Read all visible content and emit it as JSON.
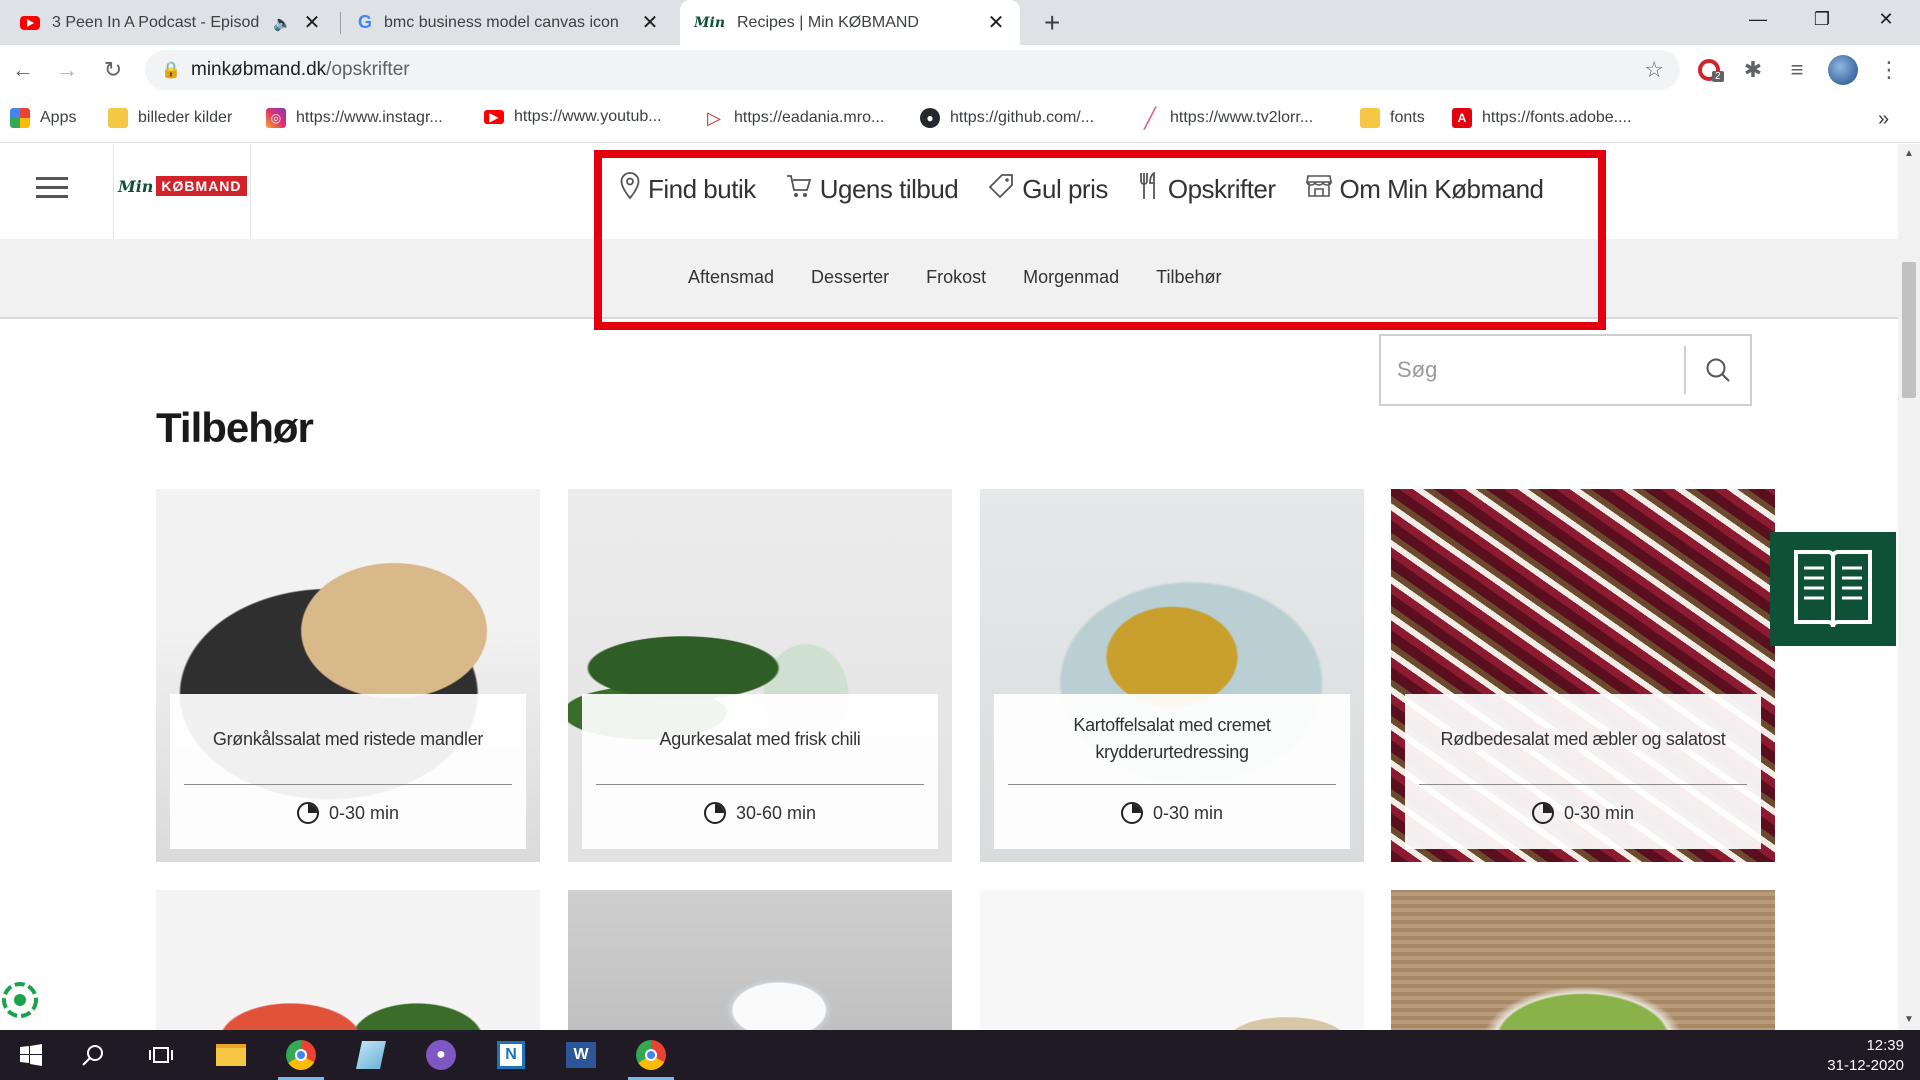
{
  "browser": {
    "tabs": [
      {
        "title": "3 Peen In A Podcast - Episod",
        "favicon": "youtube-icon",
        "audio": true
      },
      {
        "title": "bmc business model canvas icon",
        "favicon": "google-icon"
      },
      {
        "title": "Recipes | Min KØBMAND",
        "favicon": "min-koebmand-icon",
        "active": true
      }
    ],
    "new_tab": "+",
    "window_controls": {
      "minimize": "—",
      "restore": "❐",
      "close": "✕"
    },
    "url_host": "minkøbmand.dk",
    "url_path": "/opskrifter",
    "extension_badge": "2",
    "bookmarks": [
      {
        "label": "Apps",
        "icon": "apps-grid-icon"
      },
      {
        "label": "billeder kilder",
        "icon": "folder-icon"
      },
      {
        "label": "https://www.instagr...",
        "icon": "instagram-icon"
      },
      {
        "label": "https://www.youtub...",
        "icon": "youtube-icon"
      },
      {
        "label": "https://eadania.mro...",
        "icon": "eadania-icon"
      },
      {
        "label": "https://github.com/...",
        "icon": "github-icon"
      },
      {
        "label": "https://www.tv2lorr...",
        "icon": "tv2-icon"
      },
      {
        "label": "fonts",
        "icon": "folder-icon"
      },
      {
        "label": "https://fonts.adobe....",
        "icon": "adobe-icon"
      }
    ],
    "bookmarks_more": "»"
  },
  "site": {
    "logo": {
      "min": "Min",
      "brand": "KØBMAND"
    },
    "nav": [
      {
        "label": "Find butik",
        "icon": "map-pin-icon"
      },
      {
        "label": "Ugens tilbud",
        "icon": "cart-icon"
      },
      {
        "label": "Gul pris",
        "icon": "price-tag-icon"
      },
      {
        "label": "Opskrifter",
        "icon": "cutlery-icon"
      },
      {
        "label": "Om Min Købmand",
        "icon": "store-icon"
      }
    ],
    "subnav": [
      "Aftensmad",
      "Desserter",
      "Frokost",
      "Morgenmad",
      "Tilbehør"
    ],
    "search_placeholder": "Søg",
    "section_title": "Tilbehør",
    "recipes": [
      {
        "name": "Grønkålssalat med ristede mandler",
        "time": "0-30 min"
      },
      {
        "name": "Agurkesalat med frisk chili",
        "time": "30-60 min"
      },
      {
        "name": "Kartoffelsalat med cremet krydderurtedressing",
        "time": "0-30 min"
      },
      {
        "name": "Rødbedesalat med æbler og salatost",
        "time": "0-30 min"
      }
    ]
  },
  "taskbar": {
    "time": "12:39",
    "date": "31-12-2020"
  },
  "colors": {
    "brand_green": "#0e5136",
    "brand_red": "#d2232a",
    "highlight": "#e3000f"
  }
}
